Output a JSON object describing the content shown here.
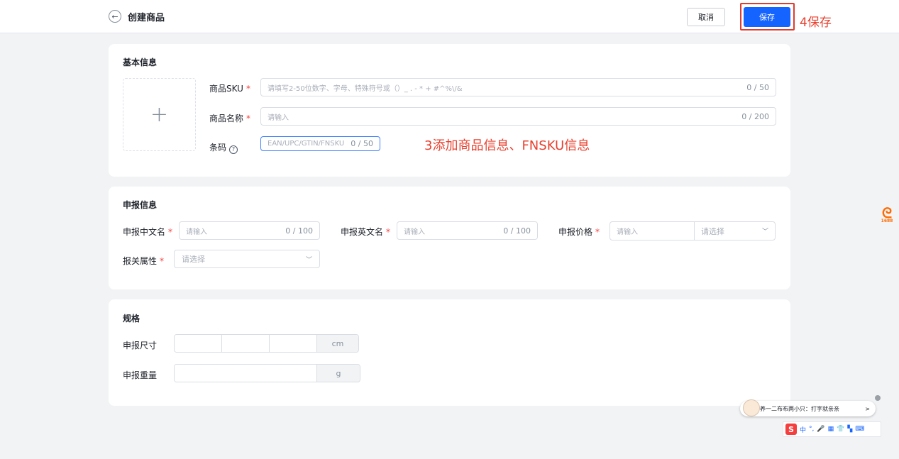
{
  "header": {
    "back_icon": "arrow-left-icon",
    "title": "创建商品",
    "cancel_label": "取消",
    "save_label": "保存",
    "save_annotation": "4保存"
  },
  "basic_info": {
    "section_title": "基本信息",
    "upload_icon": "plus-icon",
    "sku": {
      "label": "商品SKU",
      "required": "*",
      "placeholder": "请填写2-50位数字、字母、特殊符号或（）_ . - * + #^%\\/&",
      "count": "0 / 50"
    },
    "name": {
      "label": "商品名称",
      "required": "*",
      "placeholder": "请输入",
      "count": "0 / 200"
    },
    "barcode": {
      "label": "条码",
      "help_icon": "question-circle-icon",
      "placeholder": "EAN/UPC/GTIN/FNSKU",
      "count": "0 / 50"
    },
    "annotation": "3添加商品信息、FNSKU信息"
  },
  "declare_info": {
    "section_title": "申报信息",
    "cn_name": {
      "label": "申报中文名",
      "required": "*",
      "placeholder": "请输入",
      "count": "0 / 100"
    },
    "en_name": {
      "label": "申报英文名",
      "required": "*",
      "placeholder": "请输入",
      "count": "0 / 100"
    },
    "price": {
      "label": "申报价格",
      "required": "*",
      "placeholder": "请输入",
      "currency_placeholder": "请选择"
    },
    "customs_attr": {
      "label": "报关属性",
      "required": "*",
      "placeholder": "请选择"
    }
  },
  "spec": {
    "section_title": "规格",
    "size": {
      "label": "申报尺寸",
      "unit": "cm"
    },
    "weight": {
      "label": "申报重量",
      "unit": "g"
    }
  },
  "floating": {
    "app_logo_text": "1688",
    "ime_message": "养一二布布两小只：打字就亲亲",
    "ime_arrow": ">",
    "ime_logo": "S",
    "ime_items": [
      "中",
      "°,",
      "🎤",
      "▦",
      "👕",
      "▚",
      "⌨"
    ]
  }
}
